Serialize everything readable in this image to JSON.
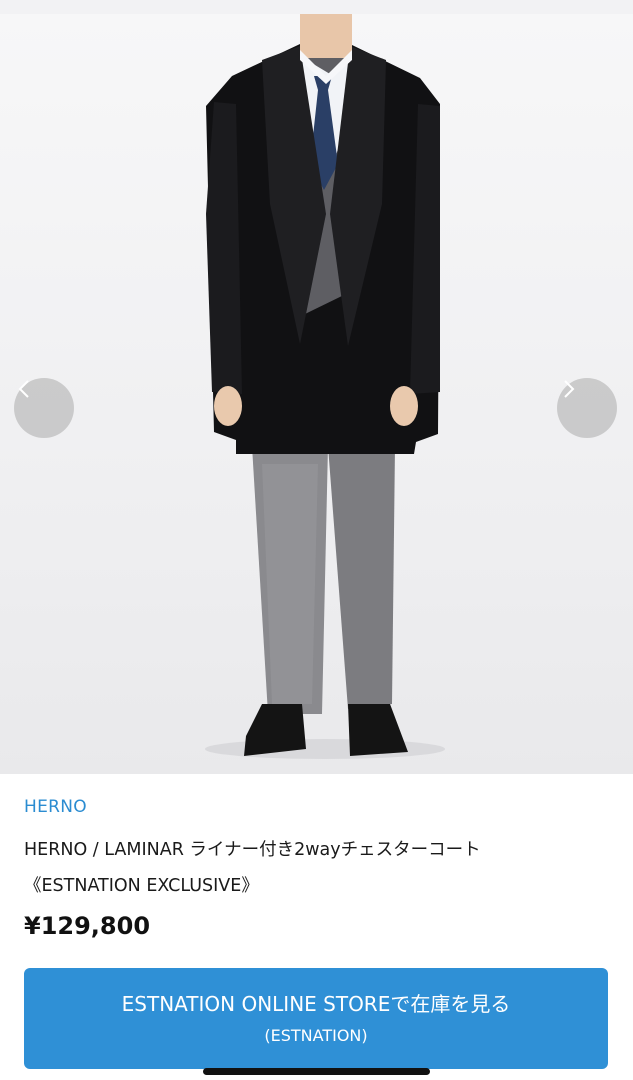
{
  "gallery": {
    "image_alt": "man wearing black chester coat with grey suit",
    "prev_icon": "chevron-left-icon",
    "next_icon": "chevron-right-icon"
  },
  "product": {
    "brand": "HERNO",
    "title_line1": "HERNO / LAMINAR ライナー付き2wayチェスターコート",
    "title_line2": "《ESTNATION EXCLUSIVE》",
    "price": "¥129,800"
  },
  "cta": {
    "label": "ESTNATION ONLINE STOREで在庫を見る",
    "sublabel": "(ESTNATION)"
  },
  "colors": {
    "accent": "#2f90d6",
    "brand_link": "#2b8cd1"
  }
}
